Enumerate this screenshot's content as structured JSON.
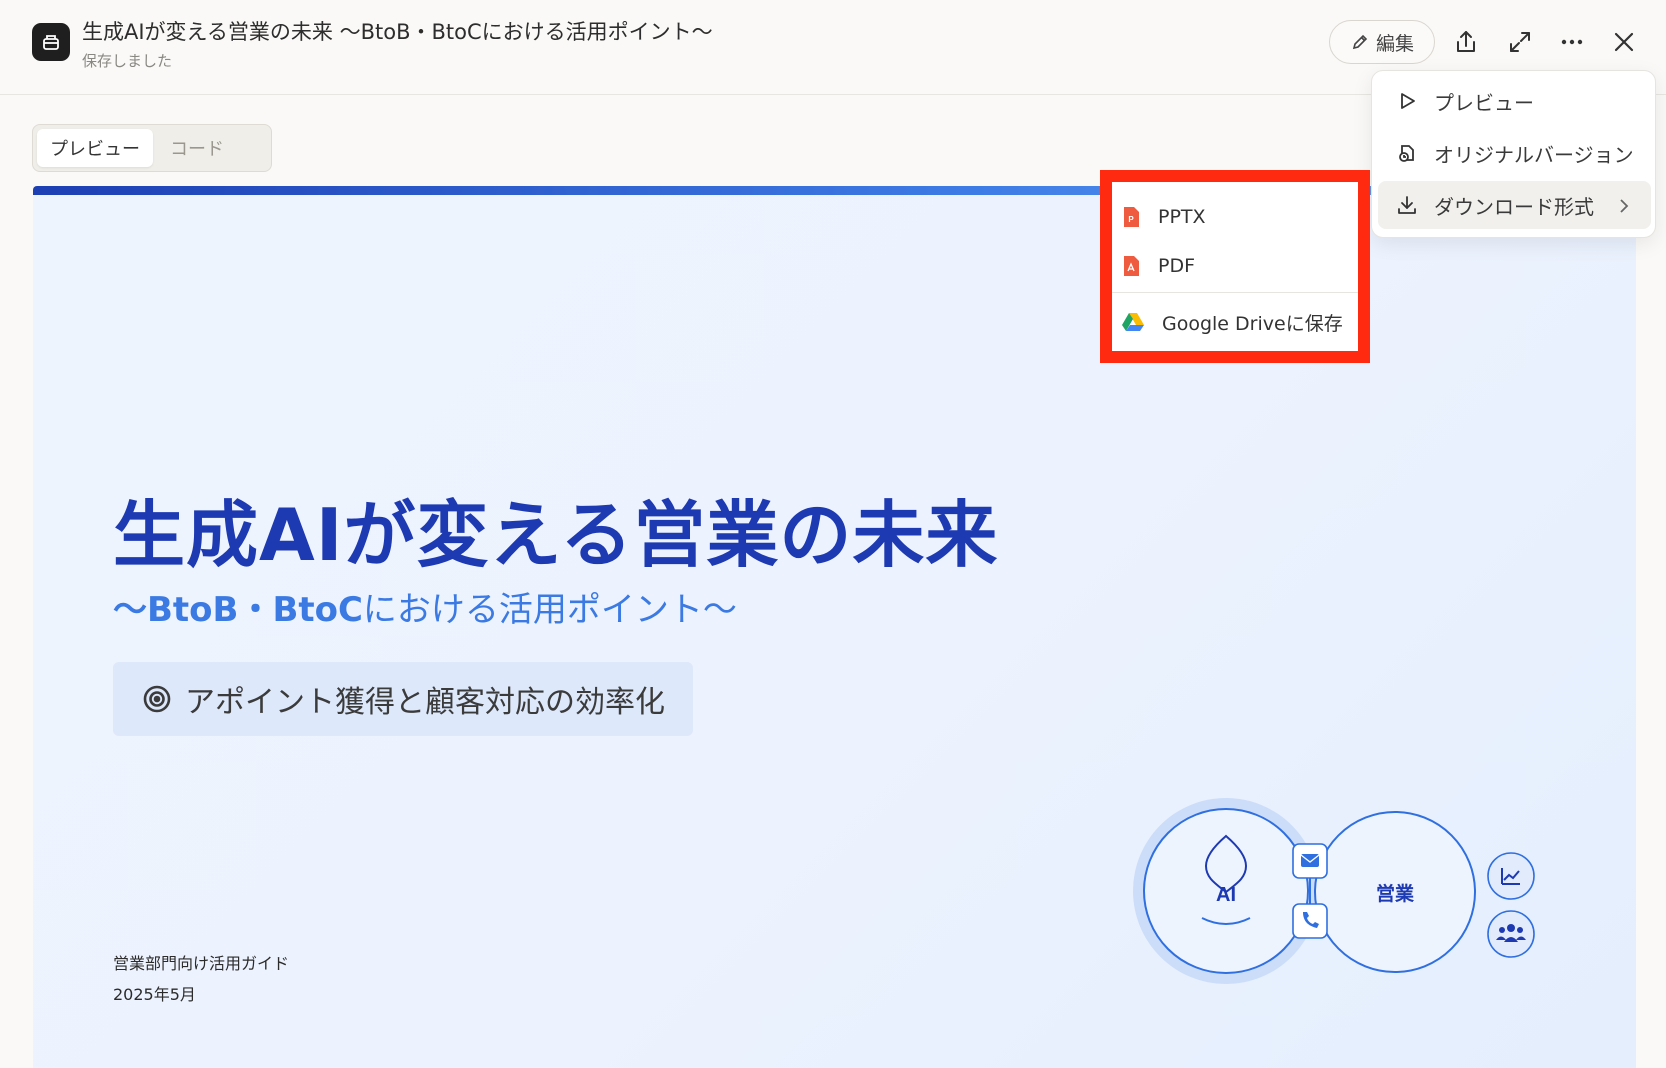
{
  "header": {
    "title": "生成AIが変える営業の未来 〜BtoB・BtoCにおける活用ポイント〜",
    "status": "保存しました",
    "edit_label": "編集"
  },
  "tabs": [
    {
      "label": "プレビュー",
      "active": true
    },
    {
      "label": "コード",
      "active": false
    }
  ],
  "slide": {
    "title": "生成AIが変える営業の未来",
    "subtitle_prefix": "〜BtoB・BtoC",
    "subtitle_rest": "における活用ポイント〜",
    "pill_text": "アポイント獲得と顧客対応の効率化",
    "footer_line1": "営業部門向け活用ガイド",
    "footer_line2": "2025年5月",
    "diagram": {
      "left_label": "AI",
      "right_label": "営業"
    },
    "colors": {
      "title": "#1e3ab3",
      "accent": "#3b7ae3"
    }
  },
  "menu": {
    "items": [
      {
        "label": "プレビュー",
        "icon": "play-icon"
      },
      {
        "label": "オリジナルバージョン",
        "icon": "history-icon"
      },
      {
        "label": "ダウンロード形式",
        "icon": "download-icon",
        "has_submenu": true
      }
    ]
  },
  "submenu": {
    "items": [
      {
        "label": "PPTX",
        "icon": "pptx-file-icon"
      },
      {
        "label": "PDF",
        "icon": "pdf-file-icon"
      },
      {
        "label": "Google Driveに保存",
        "icon": "google-drive-icon"
      }
    ],
    "highlight_color": "#ff2a0f"
  }
}
